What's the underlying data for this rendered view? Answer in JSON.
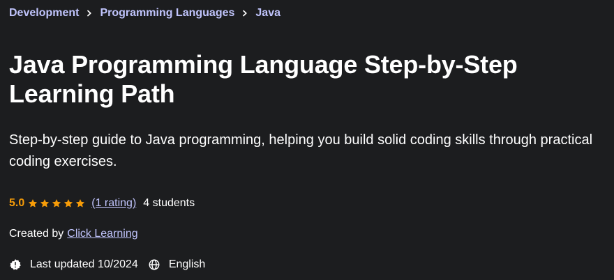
{
  "breadcrumb": {
    "items": [
      {
        "label": "Development"
      },
      {
        "label": "Programming Languages"
      },
      {
        "label": "Java"
      }
    ]
  },
  "course": {
    "title": "Java Programming Language Step-by-Step Learning Path",
    "subtitle": "Step-by-step guide to Java programming, helping you build solid coding skills through practical coding exercises.",
    "rating": {
      "score": "5.0",
      "stars": 5,
      "count_label": "(1 rating)",
      "students_label": "4 students"
    },
    "creator": {
      "prefix": "Created by",
      "name": "Click Learning"
    },
    "meta": {
      "last_updated": "Last updated 10/2024",
      "language": "English"
    }
  },
  "colors": {
    "background": "#1c1d1f",
    "link": "#c0c4fc",
    "star": "#f69c08",
    "text": "#ffffff"
  },
  "icons": {
    "breadcrumb_separator": "chevron-right-icon",
    "star": "star-icon",
    "last_updated": "alert-badge-icon",
    "language": "globe-icon"
  }
}
